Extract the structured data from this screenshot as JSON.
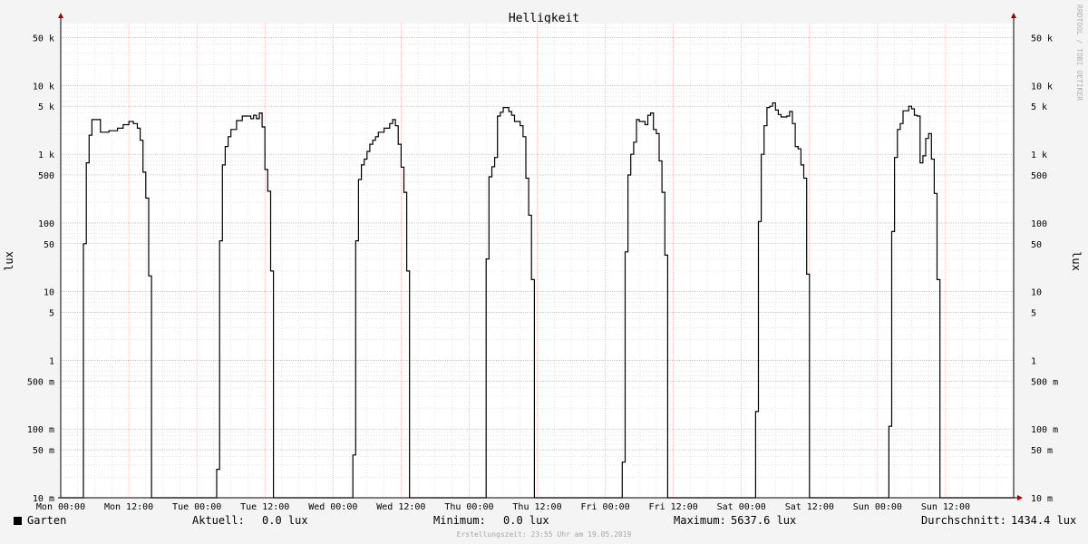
{
  "chart_data": {
    "type": "line",
    "title": "Helligkeit",
    "ylabel": "lux",
    "y_scale": "log",
    "ylim": [
      0.01,
      80000
    ],
    "grid": true,
    "y_ticks": [
      {
        "value": 50000,
        "label": "50 k"
      },
      {
        "value": 10000,
        "label": "10 k"
      },
      {
        "value": 5000,
        "label": "5 k"
      },
      {
        "value": 1000,
        "label": "1 k"
      },
      {
        "value": 500,
        "label": "500"
      },
      {
        "value": 100,
        "label": "100"
      },
      {
        "value": 50,
        "label": "50"
      },
      {
        "value": 10,
        "label": "10"
      },
      {
        "value": 5,
        "label": "5"
      },
      {
        "value": 1,
        "label": "1"
      },
      {
        "value": 0.5,
        "label": "500 m"
      },
      {
        "value": 0.1,
        "label": "100 m"
      },
      {
        "value": 0.05,
        "label": "50 m"
      },
      {
        "value": 0.01,
        "label": "10 m"
      }
    ],
    "x_range_hours": [
      0,
      168
    ],
    "x_ticks": [
      {
        "hour": 0,
        "label": "Mon 00:00"
      },
      {
        "hour": 12,
        "label": "Mon 12:00"
      },
      {
        "hour": 24,
        "label": "Tue 00:00"
      },
      {
        "hour": 36,
        "label": "Tue 12:00"
      },
      {
        "hour": 48,
        "label": "Wed 00:00"
      },
      {
        "hour": 60,
        "label": "Wed 12:00"
      },
      {
        "hour": 72,
        "label": "Thu 00:00"
      },
      {
        "hour": 84,
        "label": "Thu 12:00"
      },
      {
        "hour": 96,
        "label": "Fri 00:00"
      },
      {
        "hour": 108,
        "label": "Fri 12:00"
      },
      {
        "hour": 120,
        "label": "Sat 00:00"
      },
      {
        "hour": 132,
        "label": "Sat 12:00"
      },
      {
        "hour": 144,
        "label": "Sun 00:00"
      },
      {
        "hour": 156,
        "label": "Sun 12:00"
      }
    ],
    "series": [
      {
        "name": "Garten",
        "color": "#000000",
        "points": [
          [
            0,
            0.01
          ],
          [
            4.0,
            0.01
          ],
          [
            4.0,
            50
          ],
          [
            4.5,
            50
          ],
          [
            4.5,
            750
          ],
          [
            5.0,
            750
          ],
          [
            5.0,
            1900
          ],
          [
            5.5,
            1900
          ],
          [
            5.5,
            3200
          ],
          [
            7.0,
            3200
          ],
          [
            7.0,
            2100
          ],
          [
            8.5,
            2100
          ],
          [
            8.5,
            2200
          ],
          [
            10.0,
            2200
          ],
          [
            10.0,
            2400
          ],
          [
            11.0,
            2400
          ],
          [
            11.0,
            2700
          ],
          [
            12.0,
            2700
          ],
          [
            12.0,
            3000
          ],
          [
            12.8,
            3000
          ],
          [
            12.8,
            2800
          ],
          [
            13.5,
            2800
          ],
          [
            13.5,
            2400
          ],
          [
            14.0,
            2400
          ],
          [
            14.0,
            1600
          ],
          [
            14.5,
            1600
          ],
          [
            14.5,
            550
          ],
          [
            15.0,
            550
          ],
          [
            15.0,
            230
          ],
          [
            15.5,
            230
          ],
          [
            15.5,
            17
          ],
          [
            16.0,
            17
          ],
          [
            16.0,
            0.01
          ],
          [
            27.5,
            0.01
          ],
          [
            27.5,
            0.026
          ],
          [
            28.0,
            0.026
          ],
          [
            28.0,
            55
          ],
          [
            28.5,
            55
          ],
          [
            28.5,
            700
          ],
          [
            29.0,
            700
          ],
          [
            29.0,
            1300
          ],
          [
            29.5,
            1300
          ],
          [
            29.5,
            1800
          ],
          [
            30.0,
            1800
          ],
          [
            30.0,
            2300
          ],
          [
            31.0,
            2300
          ],
          [
            31.0,
            3100
          ],
          [
            32.0,
            3100
          ],
          [
            32.0,
            3600
          ],
          [
            33.5,
            3600
          ],
          [
            33.5,
            3300
          ],
          [
            34.0,
            3300
          ],
          [
            34.0,
            3700
          ],
          [
            34.5,
            3700
          ],
          [
            34.5,
            3300
          ],
          [
            35.0,
            3300
          ],
          [
            35.0,
            4000
          ],
          [
            35.5,
            4000
          ],
          [
            35.5,
            2500
          ],
          [
            36.0,
            2500
          ],
          [
            36.0,
            600
          ],
          [
            36.5,
            600
          ],
          [
            36.5,
            290
          ],
          [
            37.0,
            290
          ],
          [
            37.0,
            20
          ],
          [
            37.5,
            20
          ],
          [
            37.5,
            0.01
          ],
          [
            51.5,
            0.01
          ],
          [
            51.5,
            0.042
          ],
          [
            52.0,
            0.042
          ],
          [
            52.0,
            55
          ],
          [
            52.5,
            55
          ],
          [
            52.5,
            430
          ],
          [
            53.0,
            430
          ],
          [
            53.0,
            700
          ],
          [
            53.5,
            700
          ],
          [
            53.5,
            850
          ],
          [
            54.0,
            850
          ],
          [
            54.0,
            1100
          ],
          [
            54.5,
            1100
          ],
          [
            54.5,
            1400
          ],
          [
            55.0,
            1400
          ],
          [
            55.0,
            1600
          ],
          [
            55.5,
            1600
          ],
          [
            55.5,
            1800
          ],
          [
            56.0,
            1800
          ],
          [
            56.0,
            2100
          ],
          [
            57.0,
            2100
          ],
          [
            57.0,
            2400
          ],
          [
            58.0,
            2400
          ],
          [
            58.0,
            2800
          ],
          [
            58.5,
            2800
          ],
          [
            58.5,
            3200
          ],
          [
            59.0,
            3200
          ],
          [
            59.0,
            2600
          ],
          [
            59.5,
            2600
          ],
          [
            59.5,
            1400
          ],
          [
            60.0,
            1400
          ],
          [
            60.0,
            650
          ],
          [
            60.5,
            650
          ],
          [
            60.5,
            280
          ],
          [
            61.0,
            280
          ],
          [
            61.0,
            20
          ],
          [
            61.5,
            20
          ],
          [
            61.5,
            0.01
          ],
          [
            75.0,
            0.01
          ],
          [
            75.0,
            30
          ],
          [
            75.5,
            30
          ],
          [
            75.5,
            470
          ],
          [
            76.0,
            470
          ],
          [
            76.0,
            660
          ],
          [
            76.5,
            660
          ],
          [
            76.5,
            900
          ],
          [
            77.0,
            900
          ],
          [
            77.0,
            3600
          ],
          [
            77.5,
            3600
          ],
          [
            77.5,
            4100
          ],
          [
            78.0,
            4100
          ],
          [
            78.0,
            4800
          ],
          [
            79.0,
            4800
          ],
          [
            79.0,
            4200
          ],
          [
            79.5,
            4200
          ],
          [
            79.5,
            3700
          ],
          [
            80.0,
            3700
          ],
          [
            80.0,
            3000
          ],
          [
            81.0,
            3000
          ],
          [
            81.0,
            2600
          ],
          [
            81.5,
            2600
          ],
          [
            81.5,
            1800
          ],
          [
            82.0,
            1800
          ],
          [
            82.0,
            450
          ],
          [
            82.5,
            450
          ],
          [
            82.5,
            130
          ],
          [
            83.0,
            130
          ],
          [
            83.0,
            15
          ],
          [
            83.5,
            15
          ],
          [
            83.5,
            0.01
          ],
          [
            99.0,
            0.01
          ],
          [
            99.0,
            0.033
          ],
          [
            99.5,
            0.033
          ],
          [
            99.5,
            38
          ],
          [
            100.0,
            38
          ],
          [
            100.0,
            500
          ],
          [
            100.5,
            500
          ],
          [
            100.5,
            1000
          ],
          [
            101.0,
            1000
          ],
          [
            101.0,
            1500
          ],
          [
            101.5,
            1500
          ],
          [
            101.5,
            3200
          ],
          [
            102.0,
            3200
          ],
          [
            102.0,
            3000
          ],
          [
            103.0,
            3000
          ],
          [
            103.0,
            2700
          ],
          [
            103.5,
            2700
          ],
          [
            103.5,
            3700
          ],
          [
            104.0,
            3700
          ],
          [
            104.0,
            4000
          ],
          [
            104.5,
            4000
          ],
          [
            104.5,
            2300
          ],
          [
            105.0,
            2300
          ],
          [
            105.0,
            2000
          ],
          [
            105.5,
            2000
          ],
          [
            105.5,
            800
          ],
          [
            106.0,
            800
          ],
          [
            106.0,
            280
          ],
          [
            106.5,
            280
          ],
          [
            106.5,
            34
          ],
          [
            107.0,
            34
          ],
          [
            107.0,
            0.01
          ],
          [
            122.5,
            0.01
          ],
          [
            122.5,
            0.18
          ],
          [
            123.0,
            0.18
          ],
          [
            123.0,
            105
          ],
          [
            123.5,
            105
          ],
          [
            123.5,
            1000
          ],
          [
            124.0,
            1000
          ],
          [
            124.0,
            2600
          ],
          [
            124.5,
            2600
          ],
          [
            124.5,
            4800
          ],
          [
            125.0,
            4800
          ],
          [
            125.0,
            5000
          ],
          [
            125.5,
            5000
          ],
          [
            125.5,
            5600
          ],
          [
            126.0,
            5600
          ],
          [
            126.0,
            4400
          ],
          [
            126.5,
            4400
          ],
          [
            126.5,
            3800
          ],
          [
            127.0,
            3800
          ],
          [
            127.0,
            3500
          ],
          [
            128.0,
            3500
          ],
          [
            128.0,
            3600
          ],
          [
            128.5,
            3600
          ],
          [
            128.5,
            4200
          ],
          [
            129.0,
            4200
          ],
          [
            129.0,
            2800
          ],
          [
            129.5,
            2800
          ],
          [
            129.5,
            1300
          ],
          [
            130.0,
            1300
          ],
          [
            130.0,
            1200
          ],
          [
            130.5,
            1200
          ],
          [
            130.5,
            700
          ],
          [
            131.0,
            700
          ],
          [
            131.0,
            450
          ],
          [
            131.5,
            450
          ],
          [
            131.5,
            18
          ],
          [
            132.0,
            18
          ],
          [
            132.0,
            0.01
          ],
          [
            146.0,
            0.01
          ],
          [
            146.0,
            0.11
          ],
          [
            146.5,
            0.11
          ],
          [
            146.5,
            75
          ],
          [
            147.0,
            75
          ],
          [
            147.0,
            900
          ],
          [
            147.5,
            900
          ],
          [
            147.5,
            2300
          ],
          [
            148.0,
            2300
          ],
          [
            148.0,
            2800
          ],
          [
            148.5,
            2800
          ],
          [
            148.5,
            4300
          ],
          [
            149.5,
            4300
          ],
          [
            149.5,
            5000
          ],
          [
            150.0,
            5000
          ],
          [
            150.0,
            4600
          ],
          [
            150.5,
            4600
          ],
          [
            150.5,
            3700
          ],
          [
            151.0,
            3700
          ],
          [
            151.0,
            3600
          ],
          [
            151.5,
            3600
          ],
          [
            151.5,
            750
          ],
          [
            152.0,
            750
          ],
          [
            152.0,
            950
          ],
          [
            152.5,
            950
          ],
          [
            152.5,
            1700
          ],
          [
            153.0,
            1700
          ],
          [
            153.0,
            2000
          ],
          [
            153.5,
            2000
          ],
          [
            153.5,
            850
          ],
          [
            154.0,
            850
          ],
          [
            154.0,
            270
          ],
          [
            154.5,
            270
          ],
          [
            154.5,
            15
          ],
          [
            155.0,
            15
          ],
          [
            155.0,
            0.01
          ],
          [
            168,
            0.01
          ]
        ]
      }
    ],
    "legend": {
      "series_label": "Garten",
      "current_label": "Aktuell:",
      "current_value": "0.0 lux",
      "min_label": "Minimum:",
      "min_value": "0.0 lux",
      "max_label": "Maximum:",
      "max_value": "5637.6 lux",
      "avg_label": "Durchschnitt:",
      "avg_value": "1434.4 lux"
    },
    "footer": "Erstellungszeit: 23:55 Uhr am 19.05.2019",
    "watermark": "RRDTOOL / TOBI OETIKER",
    "colors": {
      "background": "#f4f4f4",
      "plot_bg": "#ffffff",
      "major_grid": "#e8a0a0",
      "minor_grid": "#c8c8c8",
      "axis": "#000000",
      "arrow": "#a00000"
    }
  }
}
